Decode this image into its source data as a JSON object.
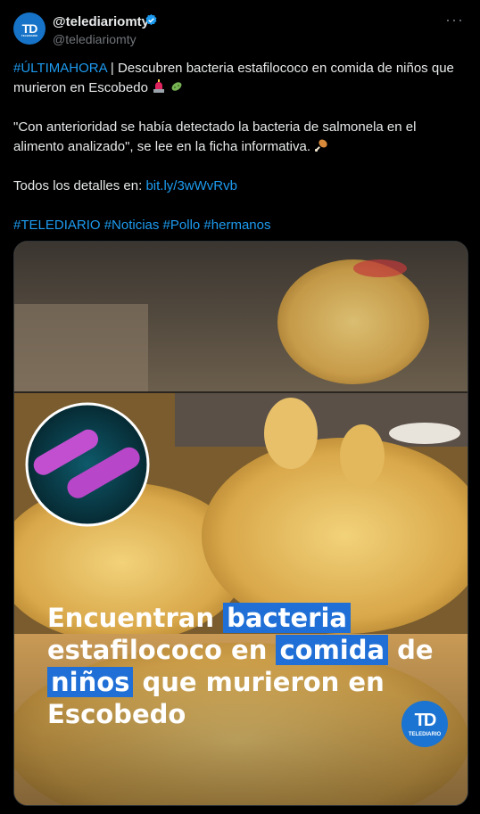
{
  "author": {
    "display_name": "@telediariomty",
    "handle": "@telediariomty",
    "avatar_text": "TD",
    "avatar_subtext": "TELEDIARIO",
    "verified_icon": "verified-badge-icon",
    "more_icon": "more-icon"
  },
  "post": {
    "hashtag_lead": "#ÚLTIMAHORA",
    "line1": " | Descubren bacteria estafilococo en comida de niños que murieron en Escobedo ",
    "quote": "\"Con anterioridad se había detectado la bacteria de salmonela en el alimento analizado\", se lee en la ficha informativa. ",
    "details_label": "Todos los detalles en: ",
    "details_link": "bit.ly/3wWvRvb",
    "hashtags": "#TELEDIARIO #Noticias #Pollo #hermanos"
  },
  "media": {
    "headline_parts": [
      {
        "text": "Encuentran ",
        "highlight": false
      },
      {
        "text": "bacteria",
        "highlight": true
      },
      {
        "text": " estafilococo en ",
        "highlight": false
      },
      {
        "text": "comida",
        "highlight": true
      },
      {
        "text": " de ",
        "highlight": false
      },
      {
        "text": "niños",
        "highlight": true
      },
      {
        "text": " que murieron en Escobedo",
        "highlight": false
      }
    ],
    "logo_text": "TD",
    "logo_subtext": "TELEDIARIO"
  },
  "colors": {
    "background": "#000000",
    "text": "#e7e9ea",
    "muted": "#71767b",
    "link": "#1d9bf0",
    "highlight": "#1f6fd6"
  }
}
